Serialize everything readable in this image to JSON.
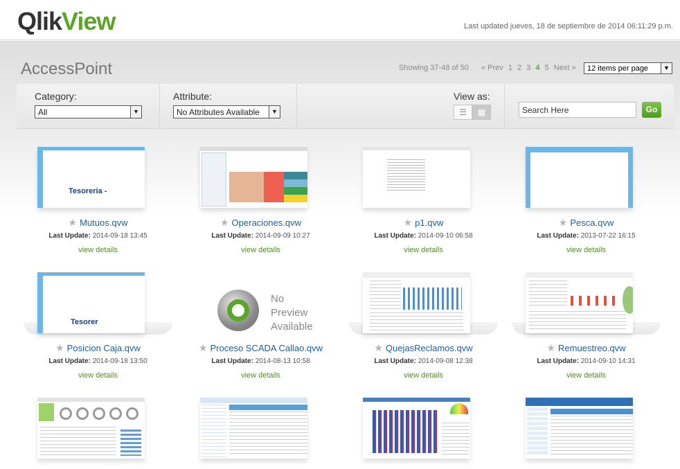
{
  "header": {
    "logo_part1": "Qlik",
    "logo_part2": "View",
    "last_updated": "Last updated jueves, 18 de septiembre de 2014 06:11:29 p.m."
  },
  "page": {
    "title": "AccessPoint",
    "showing": "Showing 37-48 of 50"
  },
  "pager": {
    "prev": "« Prev",
    "pages": [
      "1",
      "2",
      "3",
      "4",
      "5"
    ],
    "current": "4",
    "next": "Next »"
  },
  "per_page": "12 items per page",
  "toolbar": {
    "category_label": "Category:",
    "category_value": "All",
    "attribute_label": "Attribute:",
    "attribute_value": "No Attributes Available",
    "view_as_label": "View as:",
    "search_placeholder": "Search Here",
    "go_label": "Go"
  },
  "docs": [
    {
      "name": "Mutuos.qvw",
      "update_label": "Last Update:",
      "update": "2014-09-18 13:45",
      "details": "view details",
      "thumb_text": "Tesoreria -"
    },
    {
      "name": "Operaciones.qvw",
      "update_label": "Last Update:",
      "update": "2014-09-09 10:27",
      "details": "view details"
    },
    {
      "name": "p1.qvw",
      "update_label": "Last Update:",
      "update": "2014-09-10 06:58",
      "details": "view details"
    },
    {
      "name": "Pesca.qvw",
      "update_label": "Last Update:",
      "update": "2013-07-22 16:15",
      "details": "view details"
    },
    {
      "name": "Posicion Caja.qvw",
      "update_label": "Last Update:",
      "update": "2014-09-18 13:50",
      "details": "view details",
      "thumb_text": "Tesorer"
    },
    {
      "name": "Proceso SCADA Callao.qvw",
      "update_label": "Last Update:",
      "update": "2014-08-13 10:58",
      "details": "view details",
      "no_preview": [
        "No",
        "Preview",
        "Available"
      ]
    },
    {
      "name": "QuejasReclamos.qvw",
      "update_label": "Last Update:",
      "update": "2014-09-08 12:38",
      "details": "view details"
    },
    {
      "name": "Remuestreo.qvw",
      "update_label": "Last Update:",
      "update": "2014-09-10 14:31",
      "details": "view details"
    }
  ],
  "colors": {
    "brand_green": "#5aa52a",
    "link_blue": "#1e5e9a",
    "details_green": "#4f8f20"
  }
}
